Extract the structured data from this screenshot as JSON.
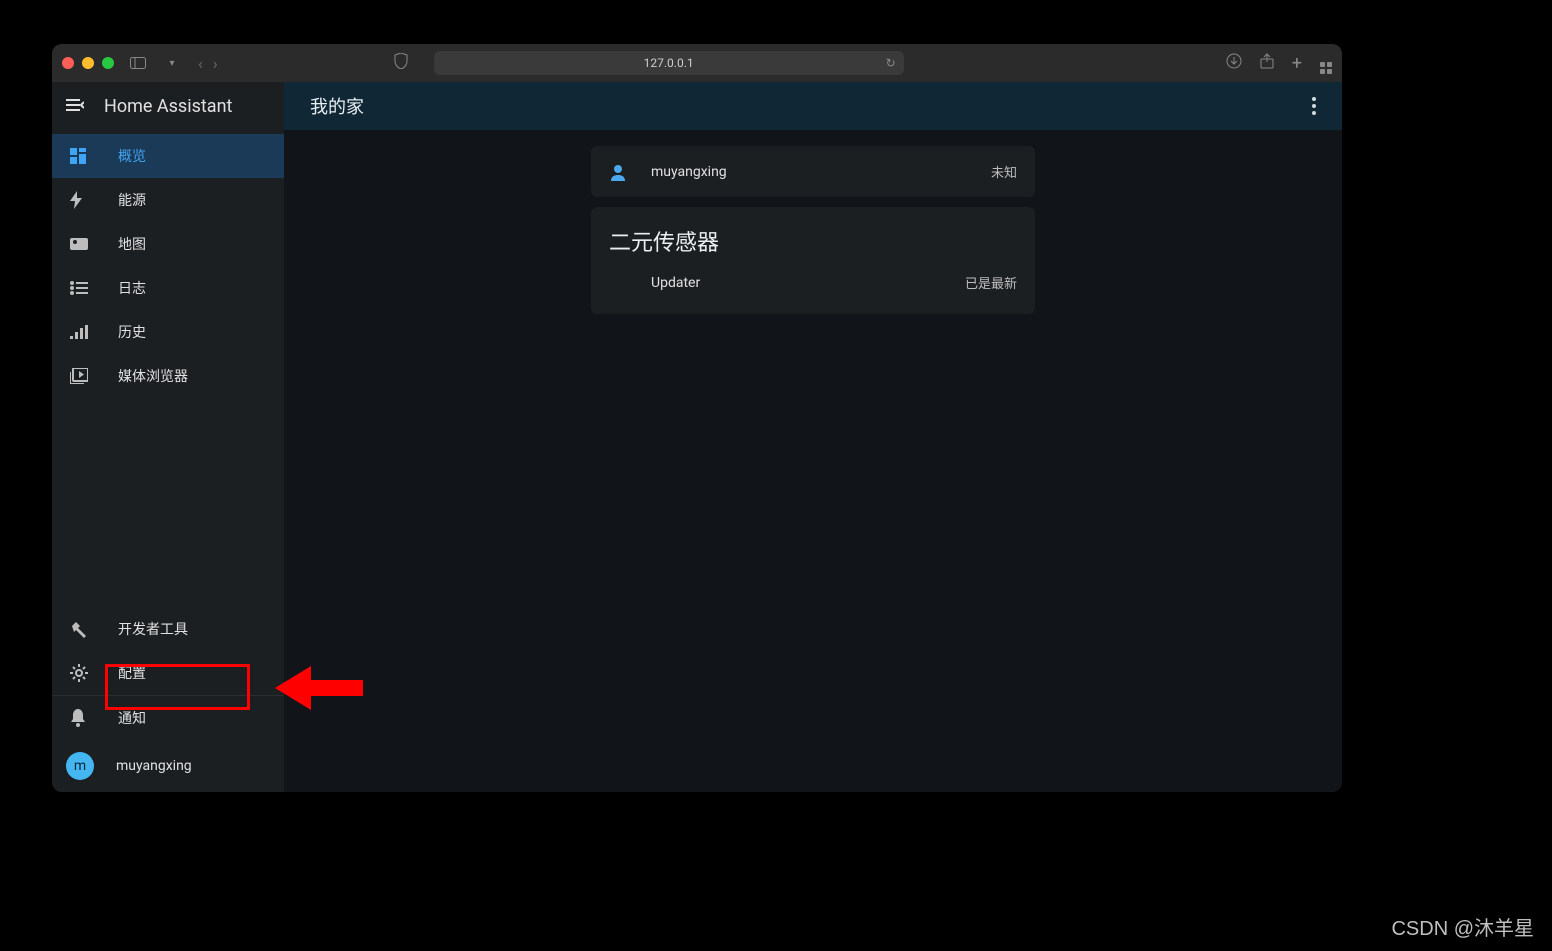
{
  "browser": {
    "address": "127.0.0.1"
  },
  "sidebar": {
    "title": "Home Assistant",
    "items": [
      {
        "label": "概览",
        "icon": "dashboard-icon"
      },
      {
        "label": "能源",
        "icon": "bolt-icon"
      },
      {
        "label": "地图",
        "icon": "map-icon"
      },
      {
        "label": "日志",
        "icon": "logbook-icon"
      },
      {
        "label": "历史",
        "icon": "history-icon"
      },
      {
        "label": "媒体浏览器",
        "icon": "media-icon"
      }
    ],
    "bottom": [
      {
        "label": "开发者工具",
        "icon": "hammer-icon"
      },
      {
        "label": "配置",
        "icon": "gear-icon"
      }
    ],
    "notifications_label": "通知",
    "user_label": "muyangxing",
    "user_initial": "m"
  },
  "topbar": {
    "title": "我的家"
  },
  "cards": {
    "person_name": "muyangxing",
    "person_state": "未知",
    "sensor_section_title": "二元传感器",
    "updater_label": "Updater",
    "updater_state": "已是最新"
  },
  "annotation": {
    "highlight_target": "配置"
  },
  "watermark": "CSDN @沐羊星"
}
